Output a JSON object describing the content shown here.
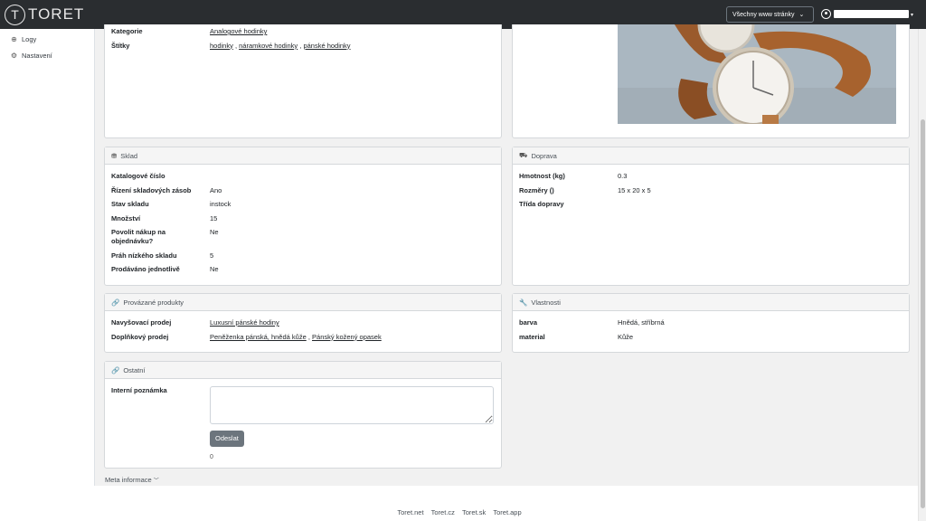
{
  "brand": {
    "logo_letter": "T",
    "name": "TORET"
  },
  "header": {
    "site_select": "Všechny www stránky",
    "site_select_chevron": "⌄",
    "user_caret": "▾"
  },
  "sidebar": {
    "items": [
      {
        "label": "Logy",
        "icon": "globe-icon",
        "glyph": "⊕"
      },
      {
        "label": "Nastavení",
        "icon": "gear-icon",
        "glyph": "⚙"
      }
    ]
  },
  "product_info": {
    "category_label": "Kategorie",
    "category_value": "Analogové hodinky",
    "tags_label": "Štítky",
    "tags": [
      "hodinky",
      "náramkové hodinky",
      "pánské hodinky"
    ],
    "tag_sep": " , "
  },
  "stock": {
    "title": "Sklad",
    "icon_glyph": "⛃",
    "rows": [
      {
        "label": "Katalogové číslo",
        "value": ""
      },
      {
        "label": "Řízení skladových zásob",
        "value": "Ano"
      },
      {
        "label": "Stav skladu",
        "value": "instock"
      },
      {
        "label": "Množství",
        "value": "15"
      },
      {
        "label": "Povolit nákup na objednávku?",
        "value": "Ne"
      },
      {
        "label": "Práh nízkého skladu",
        "value": "5"
      },
      {
        "label": "Prodáváno jednotlivě",
        "value": "Ne"
      }
    ]
  },
  "shipping": {
    "title": "Doprava",
    "icon_glyph": "⛟",
    "rows": [
      {
        "label": "Hmotnost (kg)",
        "value": "0.3"
      },
      {
        "label": "Rozměry ()",
        "value": "15 x 20 x 5"
      },
      {
        "label": "Třída dopravy",
        "value": ""
      }
    ]
  },
  "linked": {
    "title": "Provázané produkty",
    "icon_glyph": "🔗",
    "upsell_label": "Navyšovací prodej",
    "upsell_items": [
      "Luxusní pánské hodiny"
    ],
    "crosssell_label": "Doplňkový prodej",
    "crosssell_items": [
      "Peněženka pánská, hnědá kůže",
      "Pánský kožený opasek"
    ],
    "sep": " , "
  },
  "properties": {
    "title": "Vlastnosti",
    "icon_glyph": "🔧",
    "rows": [
      {
        "label": "barva",
        "value": "Hnědá, stříbrná"
      },
      {
        "label": "material",
        "value": "Kůže"
      }
    ]
  },
  "other": {
    "title": "Ostatní",
    "icon_glyph": "🔗",
    "note_label": "Interní poznámka",
    "note_value": "",
    "send_label": "Odeslat",
    "char_count": "0"
  },
  "meta": {
    "label": "Meta informace",
    "chevron": "﹀"
  },
  "footer": {
    "links": [
      "Toret.net",
      "Toret.cz",
      "Toret.sk",
      "Toret.app"
    ]
  }
}
